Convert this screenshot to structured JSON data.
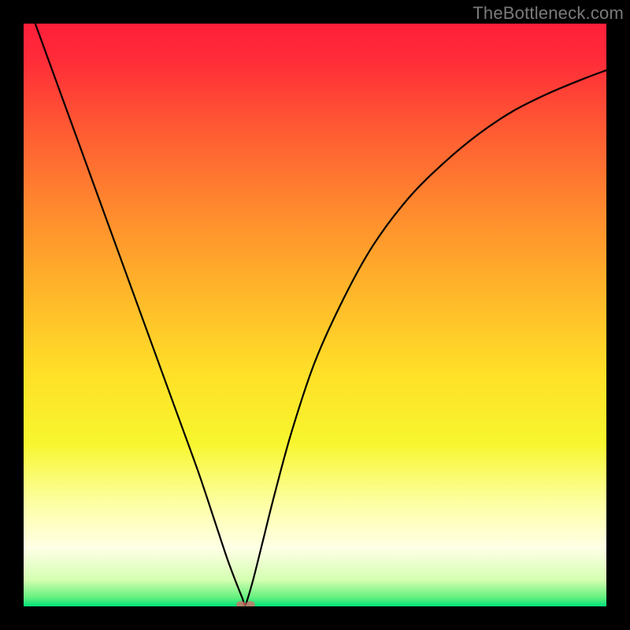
{
  "watermark": "TheBottleneck.com",
  "chart_data": {
    "type": "line",
    "title": "",
    "xlabel": "",
    "ylabel": "",
    "xlim": [
      0,
      100
    ],
    "ylim": [
      0,
      100
    ],
    "background_gradient": {
      "stops": [
        {
          "offset": 0.0,
          "color": "#ff1f3a"
        },
        {
          "offset": 0.06,
          "color": "#ff2b39"
        },
        {
          "offset": 0.18,
          "color": "#ff5a33"
        },
        {
          "offset": 0.32,
          "color": "#ff8a2e"
        },
        {
          "offset": 0.46,
          "color": "#ffb62a"
        },
        {
          "offset": 0.6,
          "color": "#ffe028"
        },
        {
          "offset": 0.72,
          "color": "#f7f62e"
        },
        {
          "offset": 0.82,
          "color": "#fdffa0"
        },
        {
          "offset": 0.9,
          "color": "#ffffe6"
        },
        {
          "offset": 0.955,
          "color": "#d4ffb0"
        },
        {
          "offset": 0.985,
          "color": "#63f07e"
        },
        {
          "offset": 1.0,
          "color": "#00e27a"
        }
      ]
    },
    "series": [
      {
        "name": "bottleneck-curve",
        "stroke": "#000000",
        "stroke_width": 2.2,
        "x": [
          2,
          6,
          10,
          14,
          18,
          22,
          26,
          30,
          33,
          35,
          36.5,
          37.5,
          38,
          38.5,
          39.5,
          41,
          43,
          46,
          50,
          55,
          60,
          66,
          72,
          78,
          84,
          90,
          96,
          100
        ],
        "y": [
          100,
          89,
          78,
          67,
          56,
          45,
          34,
          23,
          14,
          8,
          4,
          1.5,
          0.2,
          1.5,
          5,
          11,
          19,
          30,
          42,
          53,
          62,
          70,
          76,
          81,
          85,
          88,
          90.5,
          92
        ]
      }
    ],
    "markers": [
      {
        "name": "min-marker-a",
        "x": 37.3,
        "y": 0.3,
        "rx": 6,
        "ry": 4.5,
        "fill": "#e06666"
      },
      {
        "name": "min-marker-b",
        "x": 38.9,
        "y": 0.3,
        "rx": 6,
        "ry": 4.5,
        "fill": "#e06666"
      }
    ],
    "frame": {
      "stroke": "#000000",
      "width": 30
    }
  }
}
